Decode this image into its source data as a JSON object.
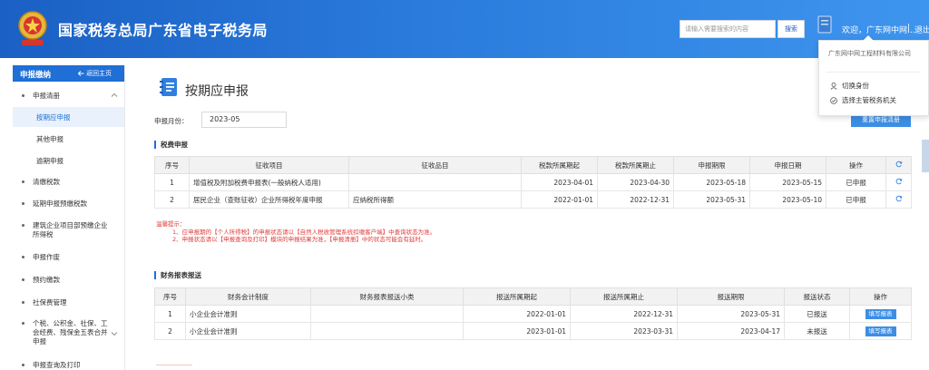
{
  "header": {
    "title": "国家税务总局广东省电子税务局",
    "search_placeholder": "请输入需要搜索的内容",
    "search_label": "搜索",
    "welcome": "欢迎，广东网中网...",
    "separator": "|",
    "logout": "退出"
  },
  "user_menu": {
    "company": "广东网中网工程材料有限公司",
    "items": [
      "切换身份",
      "选择主管税务机关"
    ]
  },
  "sidebar": {
    "title": "申报缴纳",
    "back": "返回主页",
    "groups": [
      {
        "label": "申报清册",
        "expanded": true,
        "children": [
          "按期应申报",
          "其他申报",
          "逾期申报"
        ],
        "active_child": "按期应申报"
      },
      {
        "label": "清缴税款"
      },
      {
        "label": "延期申报预缴税款"
      },
      {
        "label": "建筑企业项目部预缴企业所得税"
      },
      {
        "label": "申报作废"
      },
      {
        "label": "预约缴款"
      },
      {
        "label": "社保费管理"
      },
      {
        "label": "个税、公积金、社保、工会经费、残保金五表合并申报"
      },
      {
        "label": "申报查询及打印"
      }
    ]
  },
  "main": {
    "title": "按期应申报",
    "period_label": "申报月份：",
    "period_value": "2023-05",
    "reset_button": "重置申报清册",
    "tax_section": {
      "title": "税费申报",
      "columns": [
        "序号",
        "征收项目",
        "征收品目",
        "税款所属期起",
        "税款所属期止",
        "申报期限",
        "申报日期",
        "操作"
      ],
      "rows": [
        [
          "1",
          "增值税及附加税费申报表(一般纳税人适用)",
          "",
          "2023-04-01",
          "2023-04-30",
          "2023-05-18",
          "2023-05-15",
          "已申报"
        ],
        [
          "2",
          "居民企业（查账征收）企业所得税年度申报",
          "应纳税所得额",
          "2022-01-01",
          "2022-12-31",
          "2023-05-31",
          "2023-05-10",
          "已申报"
        ]
      ]
    },
    "tips": {
      "heading": "温馨提示：",
      "lines": [
        "1、应申报期的【个人所得税】的申报状态请以【自然人税收管理系统扣缴客户端】中查询状态为准。",
        "2、申报状态请以【申报查询及打印】模块的申报结果为准，【申报清册】中的状态可能会有延时。"
      ]
    },
    "finance_section": {
      "title": "财务报表报送",
      "columns": [
        "序号",
        "财务会计制度",
        "财务报表报送小类",
        "报送所属期起",
        "报送所属期止",
        "报送期限",
        "报送状态",
        "操作"
      ],
      "rows": [
        [
          "1",
          "小企业会计准则",
          "",
          "2022-01-01",
          "2022-12-31",
          "2023-05-31",
          "已报送",
          "填写报表"
        ],
        [
          "2",
          "小企业会计准则",
          "",
          "2023-01-01",
          "2023-03-31",
          "2023-04-17",
          "未报送",
          "填写报表"
        ]
      ]
    }
  },
  "colors": {
    "header_blue": "#2a7bdc",
    "accent": "#1f6fd6",
    "button": "#3c8ee5",
    "tip_red": "#e03b3b"
  }
}
